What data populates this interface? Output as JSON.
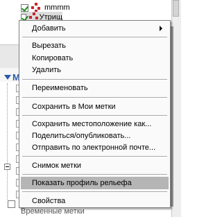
{
  "background": {
    "tree_items": [
      {
        "label": "mmmm",
        "checked": true
      },
      {
        "label": "Утрищ",
        "checked": true
      }
    ],
    "partial_header": "М",
    "bottom_item": "Временные метки"
  },
  "context_menu": {
    "items": [
      {
        "label": "Добавить",
        "submenu": true
      },
      {
        "separator": true
      },
      {
        "label": "Вырезать"
      },
      {
        "label": "Копировать"
      },
      {
        "label": "Удалить"
      },
      {
        "separator": true
      },
      {
        "label": "Переименовать"
      },
      {
        "separator": true
      },
      {
        "label": "Сохранить в Мои метки"
      },
      {
        "separator": true
      },
      {
        "label": "Сохранить местоположение как..."
      },
      {
        "label": "Поделиться/опубликовать..."
      },
      {
        "label": "Отправить по электронной почте..."
      },
      {
        "separator": true
      },
      {
        "label": "Снимок метки"
      },
      {
        "separator": true
      },
      {
        "label": "Показать профиль рельефа",
        "highlighted": true
      },
      {
        "separator": true
      },
      {
        "label": "Свойства"
      }
    ]
  },
  "colors": {
    "highlight": "#b5b5b5",
    "menu_background": "#fafafa",
    "accent": "#2a5aa8",
    "route_icon": "#c8242b",
    "checkmark": "#1f8a1f"
  }
}
